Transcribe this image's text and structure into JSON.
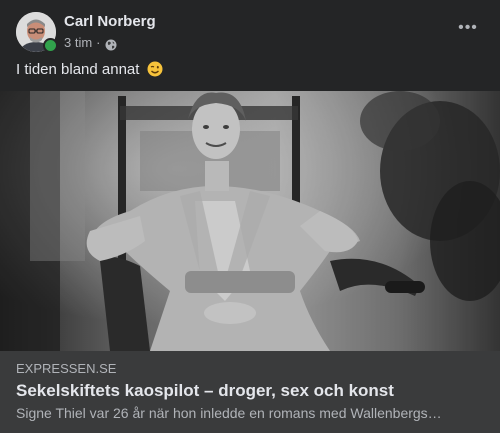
{
  "post": {
    "author": "Carl Norberg",
    "time": "3 tim",
    "separator": "·",
    "privacy_icon": "globe-icon",
    "more_icon": "more-horizontal-icon",
    "more_label": "•••",
    "caption": "I tiden bland annat",
    "caption_emoji": "winking-face-emoji",
    "online_color": "#31a24c"
  },
  "link_preview": {
    "domain": "EXPRESSEN.SE",
    "title": "Sekelskiftets kaospilot – droger, sex och konst",
    "description": "Signe Thiel var 26 år när hon inledde en romans med Wallenbergs…"
  }
}
